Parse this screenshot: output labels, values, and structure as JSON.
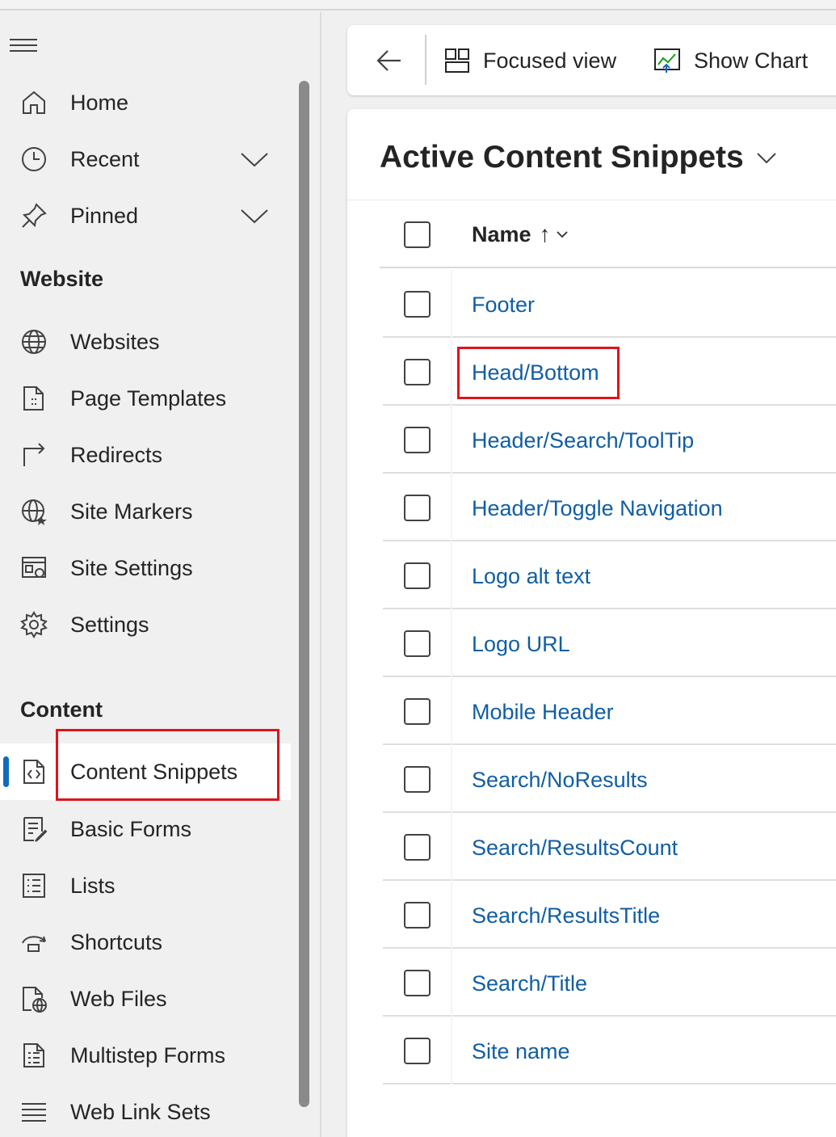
{
  "sidebar": {
    "top_items": [
      {
        "label": "Home",
        "icon": "home-icon"
      },
      {
        "label": "Recent",
        "icon": "clock-icon",
        "expandable": true
      },
      {
        "label": "Pinned",
        "icon": "pin-icon",
        "expandable": true
      }
    ],
    "sections": [
      {
        "title": "Website",
        "items": [
          {
            "label": "Websites",
            "icon": "globe-icon"
          },
          {
            "label": "Page Templates",
            "icon": "page-template-icon"
          },
          {
            "label": "Redirects",
            "icon": "redirect-icon"
          },
          {
            "label": "Site Markers",
            "icon": "globe-star-icon"
          },
          {
            "label": "Site Settings",
            "icon": "site-settings-icon"
          },
          {
            "label": "Settings",
            "icon": "gear-icon"
          }
        ]
      },
      {
        "title": "Content",
        "items": [
          {
            "label": "Content Snippets",
            "icon": "code-file-icon",
            "selected": true
          },
          {
            "label": "Basic Forms",
            "icon": "form-icon"
          },
          {
            "label": "Lists",
            "icon": "list-icon"
          },
          {
            "label": "Shortcuts",
            "icon": "shortcut-icon"
          },
          {
            "label": "Web Files",
            "icon": "web-file-icon"
          },
          {
            "label": "Multistep Forms",
            "icon": "multistep-form-icon"
          },
          {
            "label": "Web Link Sets",
            "icon": "link-set-icon"
          }
        ]
      }
    ]
  },
  "commandbar": {
    "back": "back-arrow-icon",
    "focused_view": "Focused view",
    "show_chart": "Show Chart"
  },
  "view": {
    "title": "Active Content Snippets",
    "column_name": "Name",
    "sort_indicator": "↑"
  },
  "rows": [
    "Footer",
    "Head/Bottom",
    "Header/Search/ToolTip",
    "Header/Toggle Navigation",
    "Logo alt text",
    "Logo URL",
    "Mobile Header",
    "Search/NoResults",
    "Search/ResultsCount",
    "Search/ResultsTitle",
    "Search/Title",
    "Site name"
  ],
  "colors": {
    "accent": "#0f6cbd",
    "link": "#115ea3",
    "highlight_box": "#e0121a"
  }
}
